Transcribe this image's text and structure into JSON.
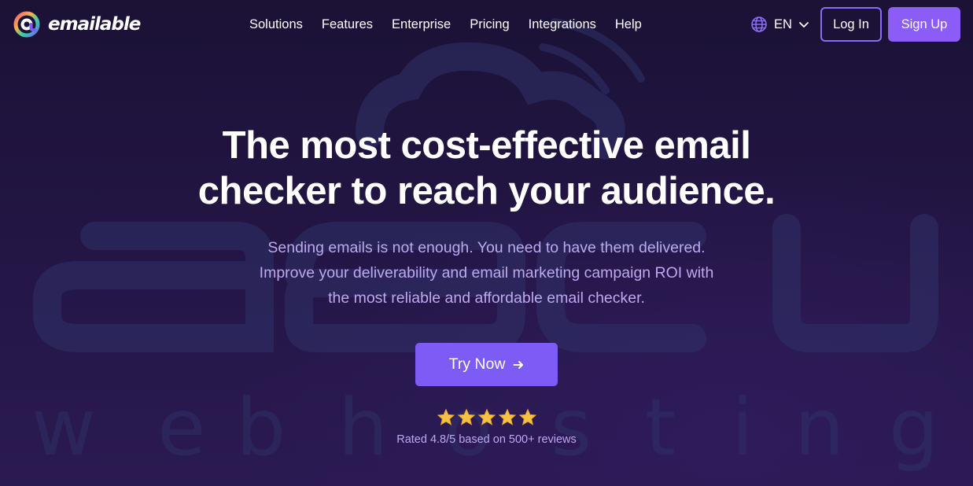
{
  "brand": {
    "name": "emailable",
    "logo_icon": "emailable-logo-icon"
  },
  "nav": {
    "items": [
      {
        "label": "Solutions"
      },
      {
        "label": "Features"
      },
      {
        "label": "Enterprise"
      },
      {
        "label": "Pricing"
      },
      {
        "label": "Integrations"
      },
      {
        "label": "Help"
      }
    ]
  },
  "language": {
    "icon": "globe-icon",
    "label": "EN",
    "dropdown_icon": "chevron-down-icon"
  },
  "auth": {
    "login_label": "Log In",
    "signup_label": "Sign Up"
  },
  "hero": {
    "title_lines": [
      "The most cost-effective email",
      "checker to reach your audience."
    ],
    "subtitle_lines": [
      "Sending emails is not enough. You need to have them delivered.",
      "Improve your deliverability and email marketing campaign ROI with",
      "the most reliable and affordable email checker."
    ],
    "cta_label": "Try Now",
    "cta_icon": "arrow-right-icon"
  },
  "rating": {
    "stars": 5,
    "star_icon": "star-icon",
    "text": "Rated 4.8/5 based on 500+ reviews"
  },
  "colors": {
    "background": "#221543",
    "accent": "#8b5cf6",
    "cta": "#7c5cf5",
    "subtitle": "#bda9f0",
    "star": "#f6c244"
  }
}
